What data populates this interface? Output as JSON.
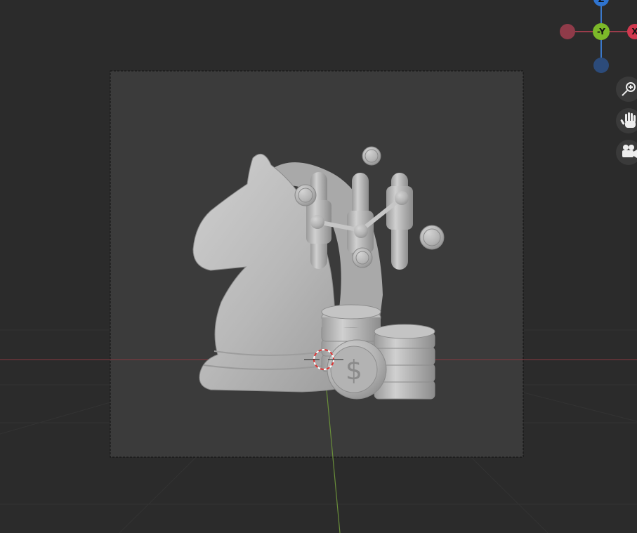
{
  "viewport": {
    "background": "#2b2b2b",
    "camera_frame_fill": "#3b3b3b",
    "axis_x_color": "#8a3a42",
    "axis_y_color": "#6a8f3a",
    "model_color": "#b9b9b9"
  },
  "gizmo": {
    "axes": [
      {
        "name": "Z",
        "label": "Z",
        "color": "#2f74d0"
      },
      {
        "name": "-X",
        "label": "",
        "color": "#8f3b49"
      },
      {
        "name": "-Y",
        "label": "-Y",
        "color": "#7cb829"
      },
      {
        "name": "X",
        "label": "X",
        "color": "#d1384e"
      },
      {
        "name": "-Z",
        "label": "",
        "color": "#2c4b7a"
      }
    ]
  },
  "navigation": [
    {
      "name": "zoom-button",
      "icon": "zoom-icon"
    },
    {
      "name": "pan-button",
      "icon": "hand-icon"
    },
    {
      "name": "camera-view-button",
      "icon": "camera-icon"
    }
  ]
}
